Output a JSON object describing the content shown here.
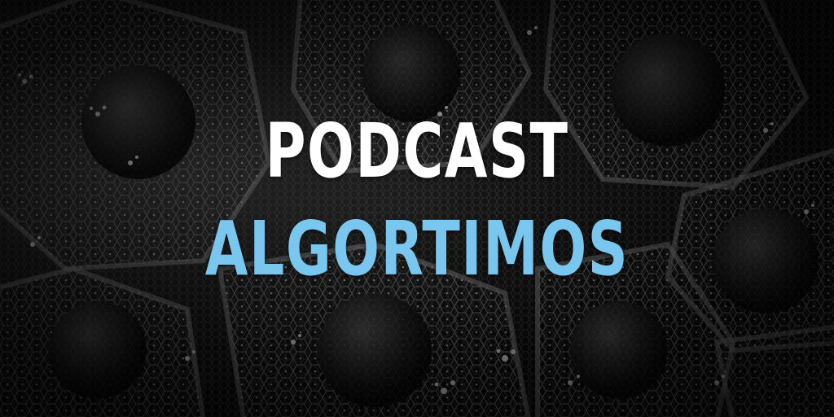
{
  "title": {
    "line1": "PODCAST",
    "line2": "ALGORTIMOS"
  },
  "colors": {
    "line1": "#ffffff",
    "line2": "#79c7ef",
    "background": "#0d0d0d",
    "pattern": "#8a8a8a"
  }
}
